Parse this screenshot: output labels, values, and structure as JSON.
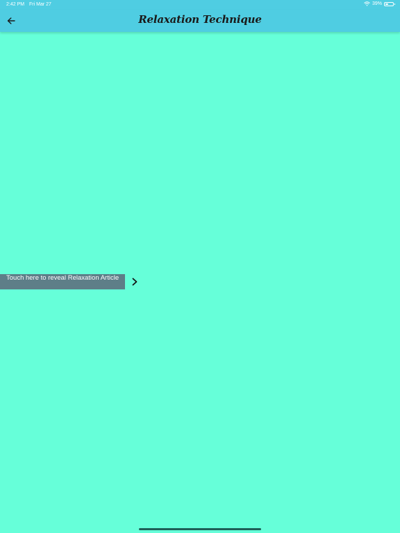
{
  "status_bar": {
    "time": "2:42 PM",
    "date": "Fri Mar 27",
    "battery_text": "39%",
    "battery_level": 0.39,
    "icons": [
      "wifi-icon",
      "battery-icon"
    ]
  },
  "nav": {
    "title": "Relaxation Technique",
    "back_icon": "arrow-left-icon"
  },
  "content": {
    "reveal_label": "Touch here to reveal Relaxation Article",
    "reveal_icon": "chevron-right-icon"
  },
  "colors": {
    "background": "#66ffd9",
    "nav_bar": "#4fcde2",
    "reveal_button": "#5e7e88",
    "title_text": "#1a1a1a"
  }
}
